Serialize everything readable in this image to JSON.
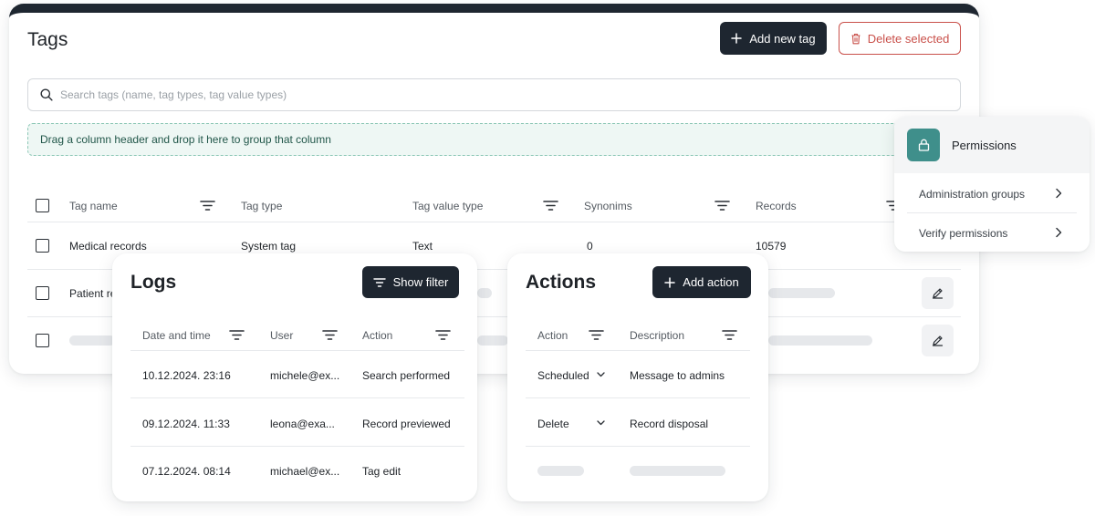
{
  "tags_page": {
    "title": "Tags",
    "add_button": "Add new tag",
    "delete_button": "Delete selected",
    "search": {
      "placeholder": "Search tags (name, tag types, tag value types)",
      "value": ""
    },
    "group_hint": "Drag a column header and drop it here to group that column",
    "columns": [
      "Tag name",
      "Tag type",
      "Tag value type",
      "Synonims",
      "Records"
    ],
    "rows": [
      {
        "tag_name": "Medical records",
        "tag_type": "System tag",
        "tag_value_type": "Text",
        "synonims": "0",
        "records": "10579"
      },
      {
        "tag_name": "Patient re",
        "tag_type": "",
        "tag_value_type": "",
        "synonims": "",
        "records": ""
      }
    ]
  },
  "permissions": {
    "title": "Permissions",
    "items": [
      "Administration groups",
      "Verify permissions"
    ]
  },
  "logs": {
    "title": "Logs",
    "filter_button": "Show filter",
    "columns": [
      "Date and time",
      "User",
      "Action"
    ],
    "rows": [
      {
        "date": "10.12.2024. 23:16",
        "user": "michele@ex...",
        "action": "Search performed"
      },
      {
        "date": "09.12.2024. 11:33",
        "user": "leona@exa...",
        "action": "Record previewed"
      },
      {
        "date": "07.12.2024. 08:14",
        "user": "michael@ex...",
        "action": "Tag edit"
      }
    ]
  },
  "actions": {
    "title": "Actions",
    "add_button": "Add action",
    "columns": [
      "Action",
      "Description"
    ],
    "rows": [
      {
        "action": "Scheduled",
        "description": "Message to admins"
      },
      {
        "action": "Delete",
        "description": "Record disposal"
      }
    ]
  },
  "colors": {
    "dark": "#1e2630",
    "danger": "#c9504a",
    "teal": "#3f8f8b",
    "banner_bg": "#eef7f4"
  },
  "icons": [
    "plus-icon",
    "trash-icon",
    "search-icon",
    "filter-icon",
    "edit-icon",
    "lock-icon",
    "chevron-right-icon",
    "chevron-down-icon"
  ]
}
